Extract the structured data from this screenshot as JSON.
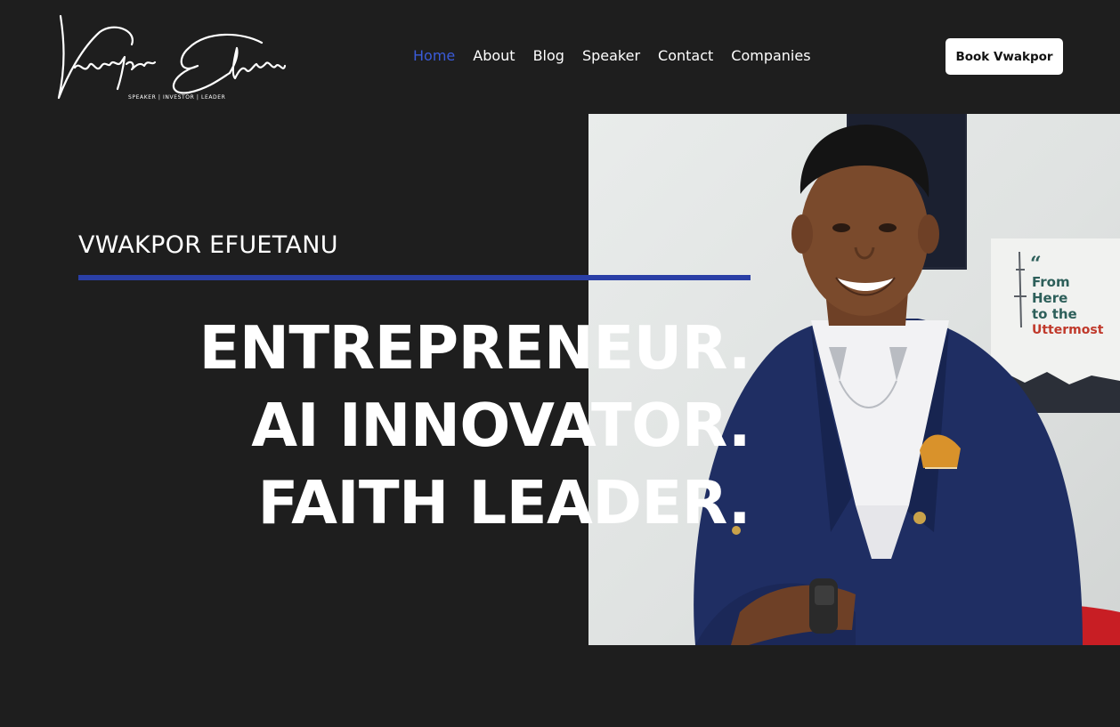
{
  "brand": {
    "logo_text": "Vwakpor Efuetanu",
    "tagline": "SPEAKER | INVESTOR | LEADER"
  },
  "nav": {
    "items": [
      {
        "label": "Home",
        "active": true
      },
      {
        "label": "About",
        "active": false
      },
      {
        "label": "Blog",
        "active": false
      },
      {
        "label": "Speaker",
        "active": false
      },
      {
        "label": "Contact",
        "active": false
      },
      {
        "label": "Companies",
        "active": false
      }
    ],
    "cta_label": "Book Vwakpor"
  },
  "hero": {
    "name": "VWAKPOR EFUETANU",
    "headline_lines": [
      "ENTREPRENEUR.",
      "AI INNOVATOR.",
      "FAITH LEADER."
    ],
    "poster_text": [
      "From",
      "Here",
      "to the",
      "Uttermost"
    ]
  },
  "colors": {
    "background": "#1e1e1e",
    "accent_blue": "#2a3fa6",
    "nav_active": "#3a5bd9",
    "text": "#ffffff"
  }
}
